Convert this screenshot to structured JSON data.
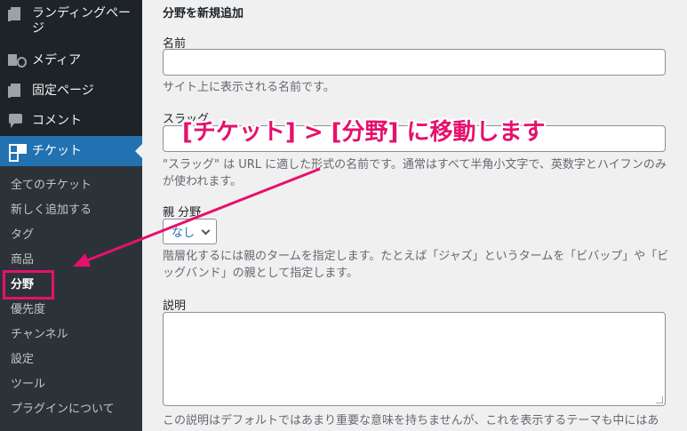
{
  "sidebar": {
    "menu": [
      {
        "label": "ランディングページ",
        "icon": "landing-page-icon"
      },
      {
        "label": "メディア",
        "icon": "media-icon"
      },
      {
        "label": "固定ページ",
        "icon": "pages-icon"
      },
      {
        "label": "コメント",
        "icon": "comment-icon"
      },
      {
        "label": "チケット",
        "icon": "ticket-icon"
      }
    ],
    "submenu": [
      {
        "label": "全てのチケット"
      },
      {
        "label": "新しく追加する"
      },
      {
        "label": "タグ"
      },
      {
        "label": "商品"
      },
      {
        "label": "分野"
      },
      {
        "label": "優先度"
      },
      {
        "label": "チャンネル"
      },
      {
        "label": "設定"
      },
      {
        "label": "ツール"
      },
      {
        "label": "プラグインについて"
      }
    ]
  },
  "form": {
    "title": "分野を新規追加",
    "name_label": "名前",
    "name_value": "",
    "name_desc": "サイト上に表示される名前です。",
    "slug_label": "スラッグ",
    "slug_value": "",
    "slug_desc": "\"スラッグ\" は URL に適した形式の名前です。通常はすべて半角小文字で、英数字とハイフンのみが使われます。",
    "parent_label": "親 分野",
    "parent_selected": "なし",
    "parent_desc": "階層化するには親のタームを指定します。たとえば「ジャズ」というタームを「ビバップ」や「ビッグバンド」の親として指定します。",
    "description_label": "説明",
    "description_value": "",
    "description_desc": "この説明はデフォルトではあまり重要な意味を持ちませんが、これを表示するテーマも中にはあ"
  },
  "annotation": {
    "text": "[チケット] > [分野] に移動します",
    "color": "#e5116d"
  },
  "colors": {
    "sidebar_bg": "#1d2327",
    "submenu_bg": "#2c3338",
    "active_bg": "#2271b1",
    "highlight": "#e5116d"
  }
}
